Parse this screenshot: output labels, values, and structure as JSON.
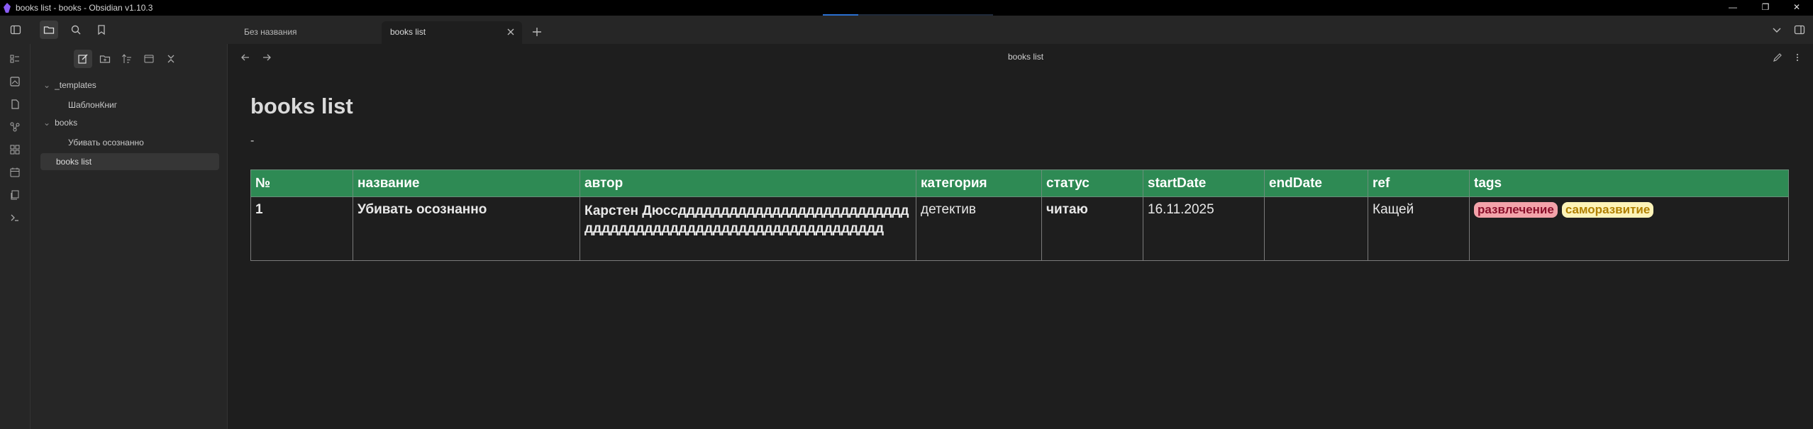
{
  "window": {
    "title": "books list - books - Obsidian v1.10.3",
    "controls": {
      "minimize": "—",
      "restore": "❐",
      "close": "✕"
    }
  },
  "tabs": [
    {
      "label": "Без названия",
      "active": false
    },
    {
      "label": "books list",
      "active": true
    }
  ],
  "file_tree": {
    "items": [
      {
        "label": "_templates",
        "type": "folder",
        "expanded": true
      },
      {
        "label": "ШаблонКниг",
        "type": "file"
      },
      {
        "label": "books",
        "type": "folder",
        "expanded": true
      },
      {
        "label": "Убивать осознанно",
        "type": "file"
      },
      {
        "label": "books list",
        "type": "file",
        "selected": true
      }
    ]
  },
  "view": {
    "header_title": "books list",
    "note_title": "books list",
    "dash": "-"
  },
  "table": {
    "headers": [
      "№",
      "название",
      "автор",
      "категория",
      "статус",
      "startDate",
      "endDate",
      "ref",
      "tags"
    ],
    "rows": [
      {
        "num": "1",
        "title": "Убивать осознанно",
        "author": "Карстен Дюссдддддддддддддддддддддддддддддддддддддддддддддддддддддддддддддд",
        "category": "детектив",
        "status": "читаю",
        "startDate": "16.11.2025",
        "endDate": "",
        "ref": "Кащей",
        "tags": [
          "развлечение",
          "саморазвитие"
        ]
      }
    ]
  },
  "colors": {
    "header_green": "#2e8a54",
    "title_green": "#7fe07f",
    "author_orange": "#ff9a1f",
    "status_yellow": "#ffd21f",
    "tag1_bg": "#f3a3aa",
    "tag2_bg": "#fdf3b8"
  }
}
